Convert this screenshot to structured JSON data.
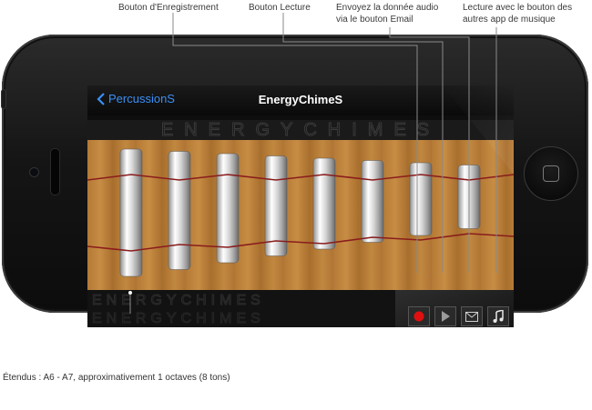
{
  "callouts": {
    "record": "Bouton d'Enregistrement",
    "play": "Bouton Lecture",
    "email_line1": "Envoyez la donnée audio",
    "email_line2": "via le bouton Email",
    "music_line1": "Lecture avec le bouton des",
    "music_line2": "autres app de musique"
  },
  "app": {
    "back_label": "PercussionS",
    "title": "EnergyChimeS",
    "banner_text": "ENERGYCHIMES"
  },
  "chimes": {
    "count": 8,
    "tube_color": "#e8e8e8",
    "string_color": "#8a1c1c"
  },
  "controls": {
    "record_color": "#e01010",
    "icons": [
      "record-icon",
      "play-icon",
      "mail-icon",
      "music-note-icon"
    ]
  },
  "footer": {
    "range_text": "Étendus : A6 - A7, approximativement 1 octaves (8 tons)"
  }
}
